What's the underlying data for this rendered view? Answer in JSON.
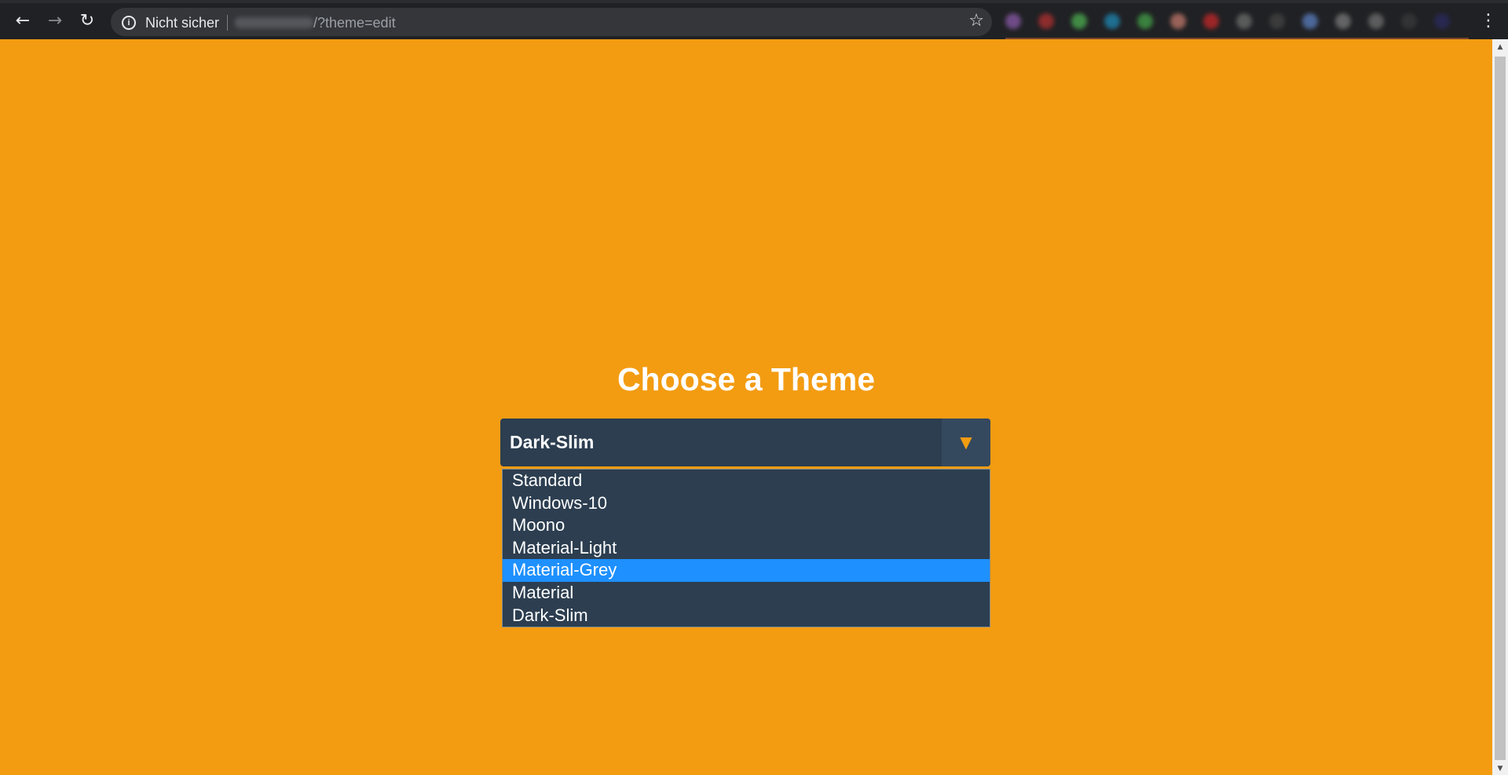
{
  "browser": {
    "security_label": "Nicht sicher",
    "url_path": "/?theme=edit",
    "back_icon": "arrow-left",
    "forward_icon": "arrow-right",
    "reload_icon": "reload",
    "info_icon": "info",
    "bookmark_icon": "star",
    "menu_icon": "kebab"
  },
  "page": {
    "title": "Choose a Theme",
    "background_color": "#f39c12"
  },
  "theme_select": {
    "selected": "Dark-Slim",
    "arrow_glyph": "▼",
    "highlighted": "Material-Grey",
    "options": [
      {
        "label": "Standard"
      },
      {
        "label": "Windows-10"
      },
      {
        "label": "Moono"
      },
      {
        "label": "Material-Light"
      },
      {
        "label": "Material-Grey"
      },
      {
        "label": "Material"
      },
      {
        "label": "Dark-Slim"
      }
    ],
    "colors": {
      "box": "#2c3e50",
      "arrow": "#f39c12",
      "highlight": "#1e90ff"
    }
  }
}
